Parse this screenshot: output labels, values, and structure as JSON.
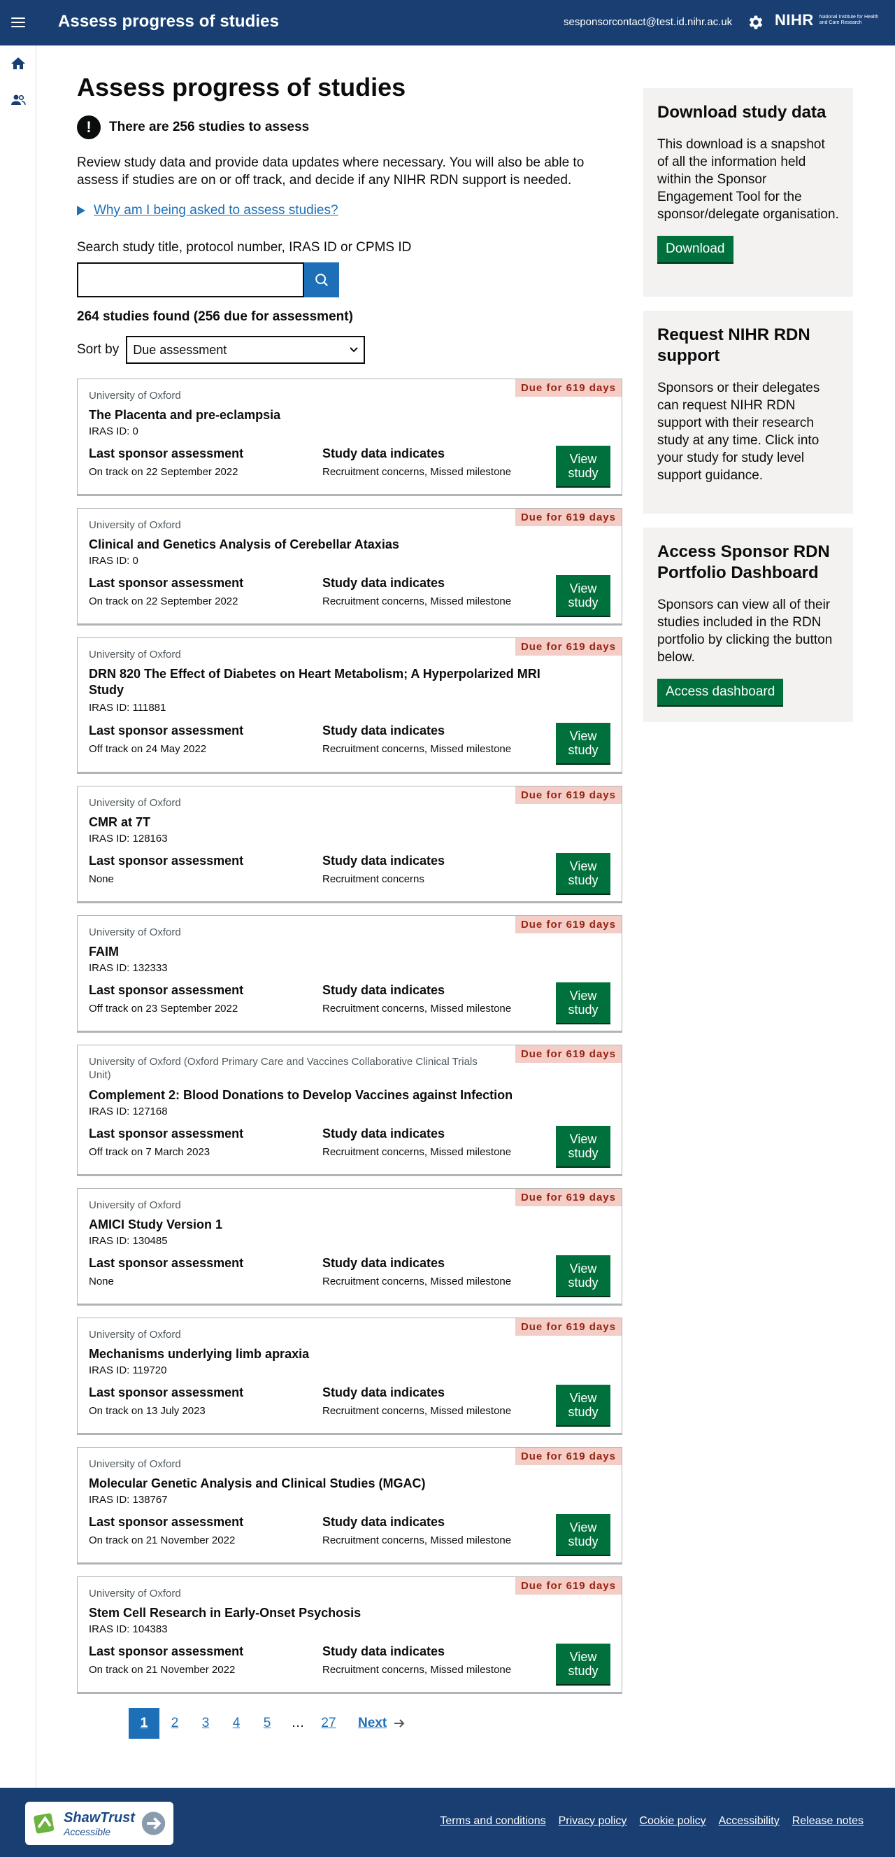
{
  "header": {
    "title": "Assess progress of studies",
    "user_email": "sesponsorcontact@test.id.nihr.ac.uk",
    "logo_word": "NIHR",
    "logo_sub": "National Institute for Health and Care Research"
  },
  "main": {
    "title": "Assess progress of studies",
    "notice": "There are 256 studies to assess",
    "intro": "Review study data and provide data updates where necessary. You will also be able to assess if studies are on or off track, and decide if any NIHR RDN support is needed.",
    "details_link": "Why am I being asked to assess studies?",
    "search_label": "Search study title, protocol number, IRAS ID or CPMS ID",
    "search_value": "",
    "results_count": "264 studies found (256 due for assessment)",
    "sort_label": "Sort by",
    "sort_value": "Due assessment"
  },
  "labels": {
    "last_assessment": "Last sponsor assessment",
    "data_indicates": "Study data indicates",
    "view_line1": "View",
    "view_line2": "study"
  },
  "studies": [
    {
      "org": "University of Oxford",
      "title": "The Placenta and pre-eclampsia",
      "iras": "IRAS ID: 0",
      "assessment": "On track on 22 September 2022",
      "indicates": "Recruitment concerns, Missed milestone",
      "due": "Due for 619 days"
    },
    {
      "org": "University of Oxford",
      "title": "Clinical and Genetics Analysis of Cerebellar Ataxias",
      "iras": "IRAS ID: 0",
      "assessment": "On track on 22 September 2022",
      "indicates": "Recruitment concerns, Missed milestone",
      "due": "Due for 619 days"
    },
    {
      "org": "University of Oxford",
      "title": "DRN 820 The Effect of Diabetes on Heart Metabolism; A Hyperpolarized MRI Study",
      "iras": "IRAS ID: 111881",
      "assessment": "Off track on 24 May 2022",
      "indicates": "Recruitment concerns, Missed milestone",
      "due": "Due for 619 days"
    },
    {
      "org": "University of Oxford",
      "title": "CMR at 7T",
      "iras": "IRAS ID: 128163",
      "assessment": "None",
      "indicates": "Recruitment concerns",
      "due": "Due for 619 days"
    },
    {
      "org": "University of Oxford",
      "title": "FAIM",
      "iras": "IRAS ID: 132333",
      "assessment": "Off track on 23 September 2022",
      "indicates": "Recruitment concerns, Missed milestone",
      "due": "Due for 619 days"
    },
    {
      "org": "University of Oxford (Oxford Primary Care and Vaccines Collaborative Clinical Trials Unit)",
      "title": "Complement 2: Blood Donations to Develop Vaccines against Infection",
      "iras": "IRAS ID: 127168",
      "assessment": "Off track on 7 March 2023",
      "indicates": "Recruitment concerns, Missed milestone",
      "due": "Due for 619 days"
    },
    {
      "org": "University of Oxford",
      "title": "AMICI Study Version 1",
      "iras": "IRAS ID: 130485",
      "assessment": "None",
      "indicates": "Recruitment concerns, Missed milestone",
      "due": "Due for 619 days"
    },
    {
      "org": "University of Oxford",
      "title": "Mechanisms underlying limb apraxia",
      "iras": "IRAS ID: 119720",
      "assessment": "On track on 13 July 2023",
      "indicates": "Recruitment concerns, Missed milestone",
      "due": "Due for 619 days"
    },
    {
      "org": "University of Oxford",
      "title": "Molecular Genetic Analysis and Clinical Studies (MGAC)",
      "iras": "IRAS ID: 138767",
      "assessment": "On track on 21 November 2022",
      "indicates": "Recruitment concerns, Missed milestone",
      "due": "Due for 619 days"
    },
    {
      "org": "University of Oxford",
      "title": "Stem Cell Research in Early-Onset Psychosis",
      "iras": "IRAS ID: 104383",
      "assessment": "On track on 21 November 2022",
      "indicates": "Recruitment concerns, Missed milestone",
      "due": "Due for 619 days"
    }
  ],
  "pagination": {
    "pages": [
      "1",
      "2",
      "3",
      "4",
      "5",
      "…",
      "27"
    ],
    "current": "1",
    "next": "Next"
  },
  "sidebar": {
    "download": {
      "title": "Download study data",
      "body": "This download is a snapshot of all the information held within the Sponsor Engagement Tool for the sponsor/delegate organisation.",
      "button": "Download"
    },
    "request": {
      "title": "Request NIHR RDN support",
      "body": "Sponsors or their delegates can request NIHR RDN support with their research study at any time. Click into your study for study level support guidance."
    },
    "dashboard": {
      "title": "Access Sponsor RDN Portfolio Dashboard",
      "body": "Sponsors can view all of their studies included in the RDN portfolio by clicking the button below.",
      "button": "Access dashboard"
    }
  },
  "footer": {
    "badge_line1": "ShawTrust",
    "badge_line2": "Accessible",
    "links": [
      "Terms and conditions",
      "Privacy policy",
      "Cookie policy",
      "Accessibility",
      "Release notes"
    ]
  },
  "colors": {
    "header_bg": "#193e72",
    "link": "#1d70b8",
    "button_green": "#00703c",
    "due_badge_bg": "#f4cdc6",
    "due_badge_text": "#942514",
    "panel_bg": "#f3f2f1"
  }
}
